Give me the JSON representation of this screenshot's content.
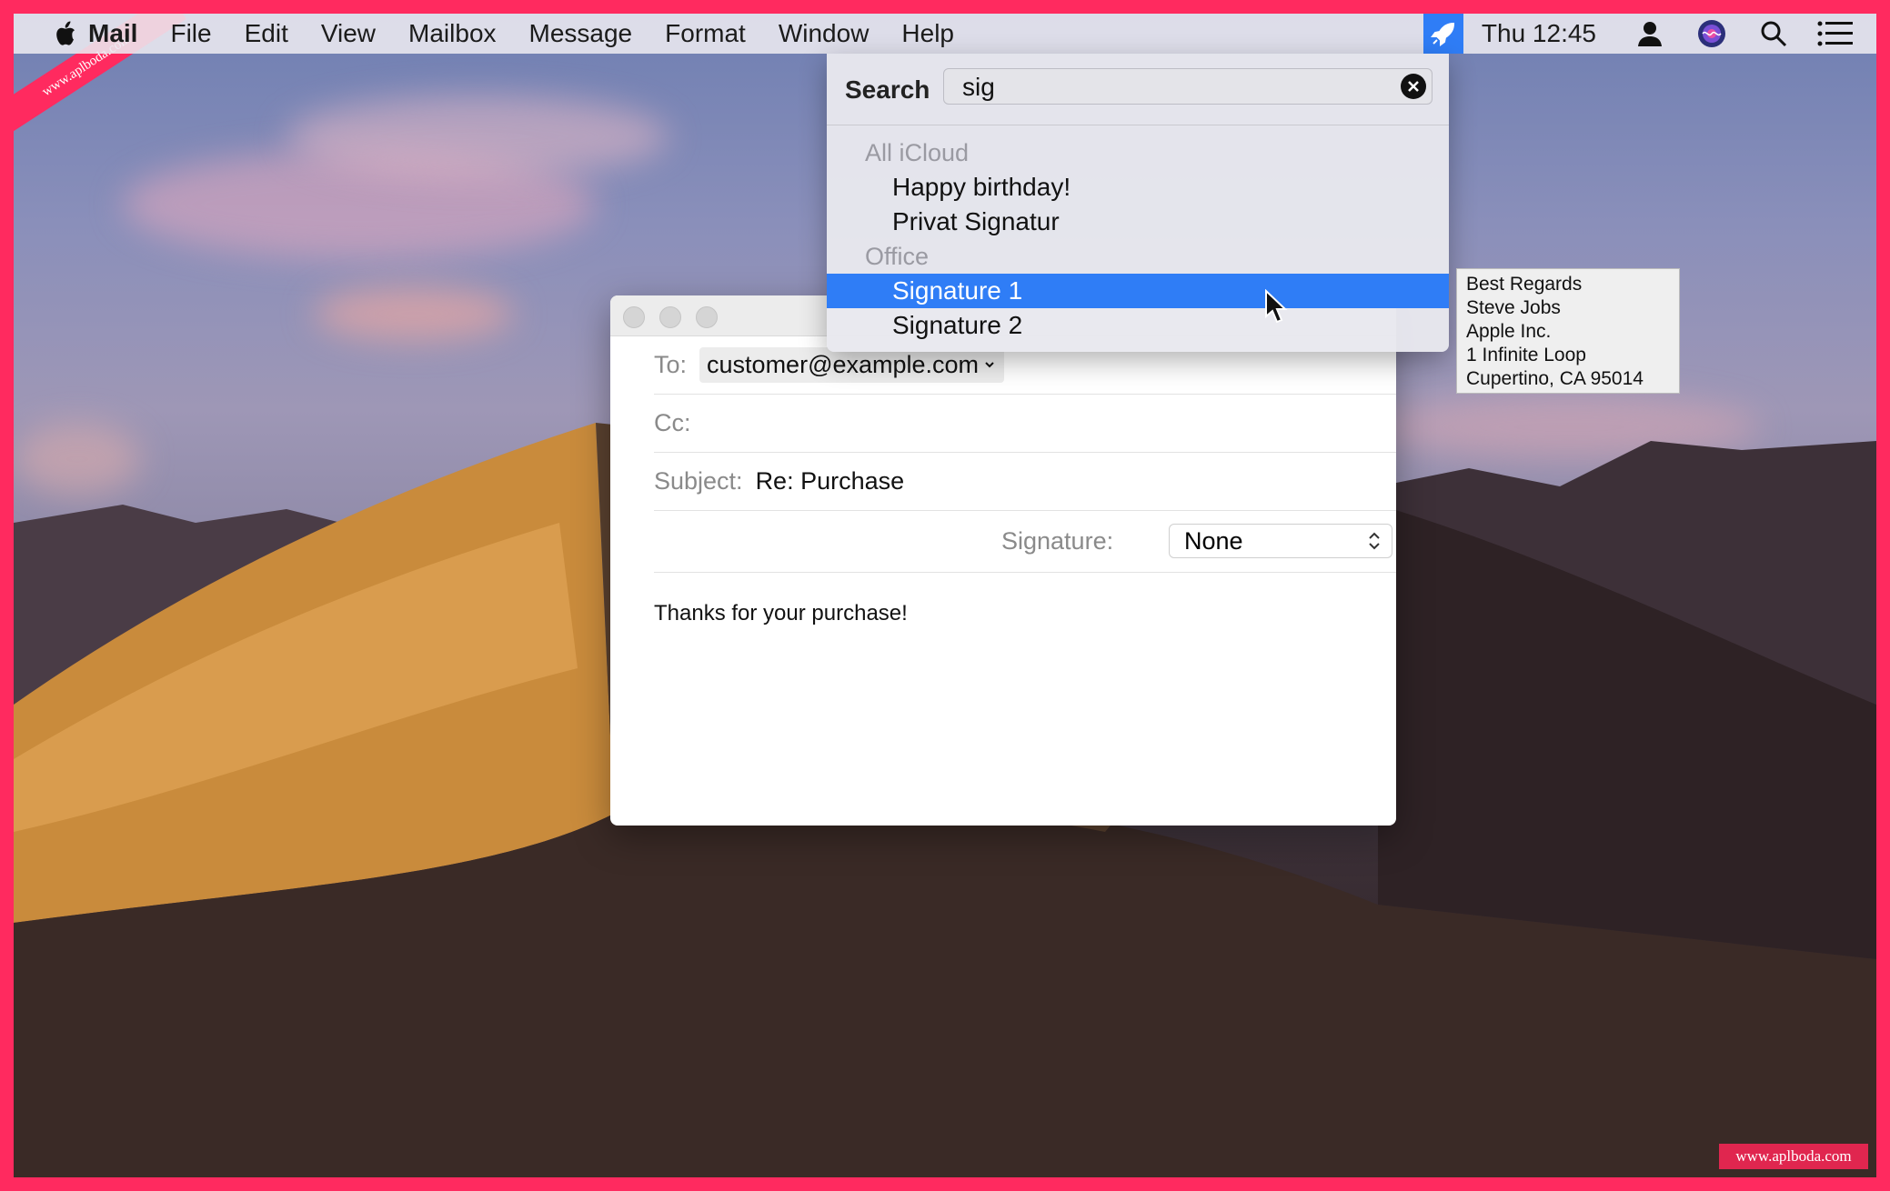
{
  "menubar": {
    "app_name": "Mail",
    "items": [
      "File",
      "Edit",
      "View",
      "Mailbox",
      "Message",
      "Format",
      "Window",
      "Help"
    ],
    "clock": "Thu 12:45",
    "status_icons": [
      "rocket-icon",
      "user-icon",
      "siri-icon",
      "search-icon",
      "list-icon"
    ]
  },
  "popup": {
    "search_label": "Search",
    "search_value": "sig",
    "groups": [
      {
        "title": "All iCloud",
        "items": [
          "Happy birthday!",
          "Privat Signatur"
        ]
      },
      {
        "title": "Office",
        "items": [
          "Signature 1",
          "Signature 2"
        ]
      }
    ],
    "selected": "Signature 1"
  },
  "tooltip": {
    "lines": [
      "Best Regards",
      "Steve Jobs",
      "Apple Inc.",
      "1 Infinite Loop",
      "Cupertino, CA 95014"
    ]
  },
  "compose": {
    "to_label": "To:",
    "to_value": "customer@example.com",
    "cc_label": "Cc:",
    "subject_label": "Subject:",
    "subject_value": "Re: Purchase",
    "signature_label": "Signature:",
    "signature_value": "None",
    "body": "Thanks for your purchase!"
  },
  "watermark": {
    "corner": "www.aplboda.com",
    "bottom_right": "www.aplboda.com"
  },
  "colors": {
    "frame": "#ff2a5f",
    "selection": "#2f7df6"
  }
}
